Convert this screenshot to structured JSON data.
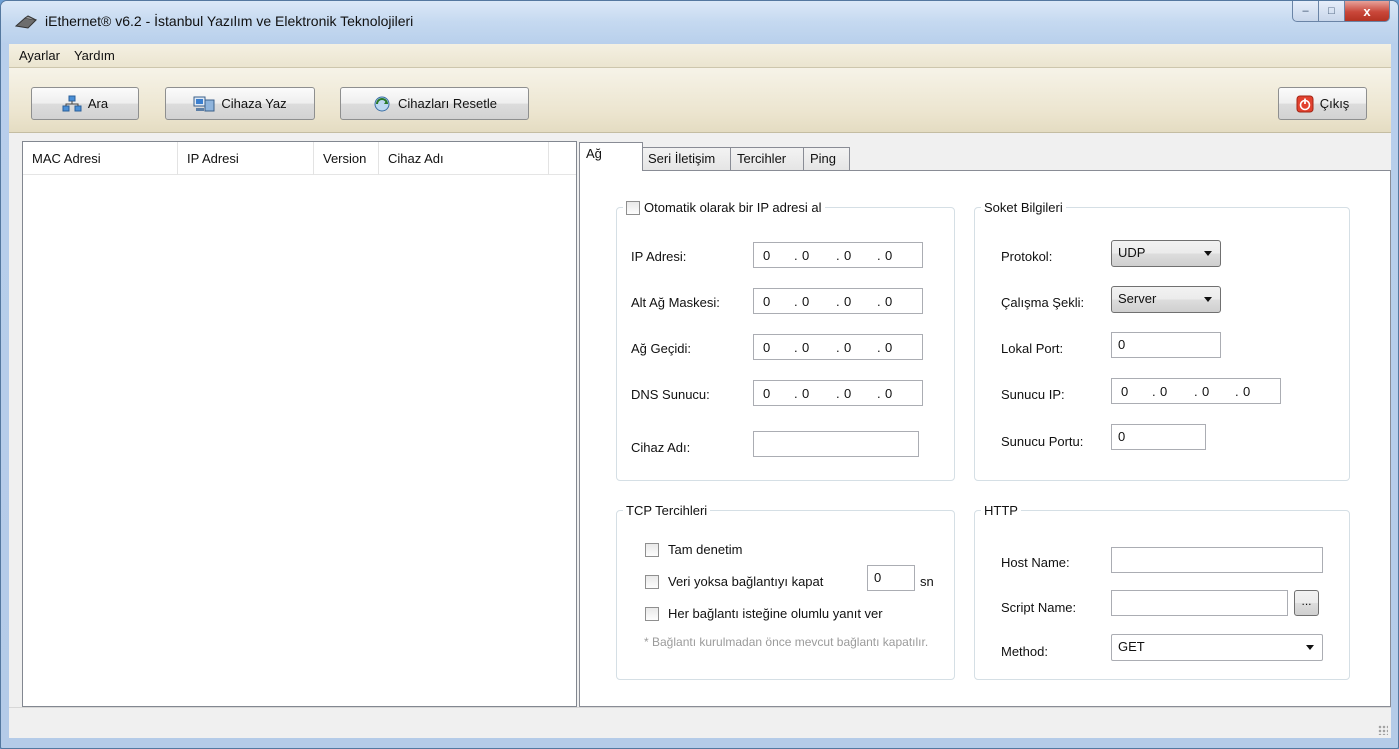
{
  "window": {
    "title": "iEthernet® v6.2 - İstanbul Yazılım ve Elektronik Teknolojileri",
    "controls": {
      "minimize": "–",
      "maximize": "□",
      "close": "x"
    }
  },
  "menu": {
    "items": [
      "Ayarlar",
      "Yardım"
    ]
  },
  "toolbar": {
    "search_label": "Ara",
    "write_label": "Cihaza Yaz",
    "reset_label": "Cihazları Resetle",
    "exit_label": "Çıkış"
  },
  "device_list": {
    "columns": [
      "MAC Adresi",
      "IP Adresi",
      "Version",
      "Cihaz Adı"
    ],
    "rows": []
  },
  "tabs": [
    {
      "label": "Ağ",
      "active": true
    },
    {
      "label": "Seri İletişim",
      "active": false
    },
    {
      "label": "Tercihler",
      "active": false
    },
    {
      "label": "Ping",
      "active": false
    }
  ],
  "network": {
    "auto_ip_label": "Otomatik olarak bir IP adresi al",
    "auto_ip_checked": false,
    "ip_label": "IP Adresi:",
    "ip_value": [
      "0",
      "0",
      "0",
      "0"
    ],
    "mask_label": "Alt Ağ Maskesi:",
    "mask_value": [
      "0",
      "0",
      "0",
      "0"
    ],
    "gateway_label": "Ağ Geçidi:",
    "gateway_value": [
      "0",
      "0",
      "0",
      "0"
    ],
    "dns_label": "DNS Sunucu:",
    "dns_value": [
      "0",
      "0",
      "0",
      "0"
    ],
    "device_name_label": "Cihaz Adı:",
    "device_name_value": "",
    "dot": "."
  },
  "socket": {
    "group_title": "Soket Bilgileri",
    "protocol_label": "Protokol:",
    "protocol_value": "UDP",
    "mode_label": "Çalışma Şekli:",
    "mode_value": "Server",
    "local_port_label": "Lokal Port:",
    "local_port_value": "0",
    "server_ip_label": "Sunucu IP:",
    "server_ip_value": [
      "0",
      "0",
      "0",
      "0"
    ],
    "server_port_label": "Sunucu Portu:",
    "server_port_value": "0"
  },
  "tcp": {
    "group_title": "TCP Tercihleri",
    "full_control_label": "Tam denetim",
    "close_idle_label": "Veri yoksa bağlantıyı kapat",
    "close_idle_value": "0",
    "close_idle_unit": "sn",
    "accept_all_label": "Her bağlantı isteğine olumlu yanıt ver",
    "note": "* Bağlantı kurulmadan önce mevcut bağlantı kapatılır."
  },
  "http": {
    "group_title": "HTTP",
    "host_label": "Host Name:",
    "host_value": "",
    "script_label": "Script Name:",
    "script_value": "",
    "browse_label": "...",
    "method_label": "Method:",
    "method_value": "GET"
  },
  "status": {
    "text": ""
  }
}
